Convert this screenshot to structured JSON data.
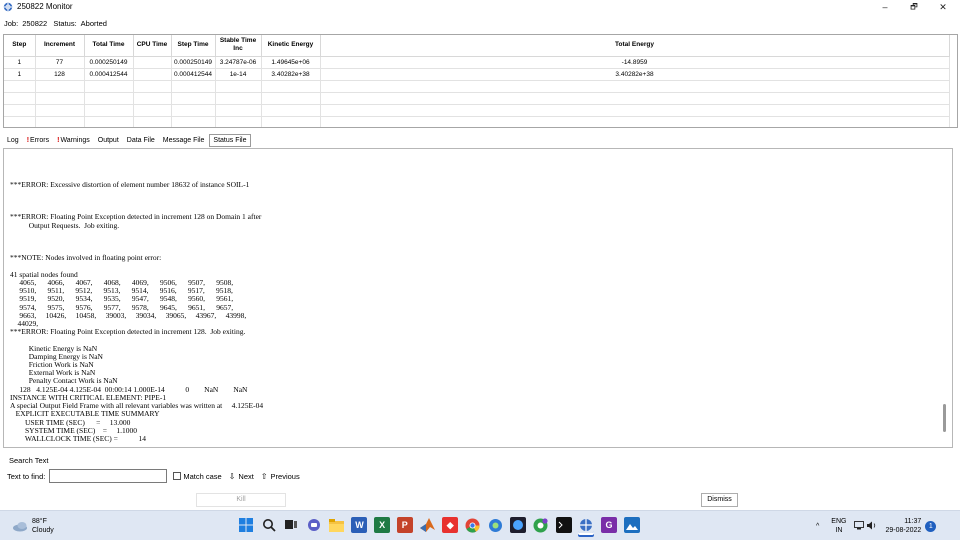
{
  "window": {
    "title": "250822 Monitor",
    "minimize": "–",
    "restore": "🗗",
    "close": "✕"
  },
  "job": {
    "label": "Job:",
    "name": "250822",
    "status_label": "Status:",
    "status": "Aborted"
  },
  "table": {
    "headers": [
      "Step",
      "Increment",
      "Total Time",
      "CPU Time",
      "Step Time",
      "Stable Time Inc",
      "Kinetic Energy",
      "Total Energy"
    ],
    "rows": [
      [
        "1",
        "77",
        "0.000250149",
        "",
        "0.000250149",
        "3.24787e-06",
        "1.49645e+06",
        "-14.8959"
      ],
      [
        "1",
        "128",
        "0.000412544",
        "",
        "0.000412544",
        "1e-14",
        "3.40282e+38",
        "3.40282e+38"
      ]
    ]
  },
  "tabs": [
    {
      "label": "Log",
      "warn": false,
      "active": false
    },
    {
      "label": "Errors",
      "warn": true,
      "active": false
    },
    {
      "label": "Warnings",
      "warn": true,
      "active": false
    },
    {
      "label": "Output",
      "warn": false,
      "active": false
    },
    {
      "label": "Data File",
      "warn": false,
      "active": false
    },
    {
      "label": "Message File",
      "warn": false,
      "active": false
    },
    {
      "label": "Status File",
      "warn": false,
      "active": true
    }
  ],
  "log": {
    "text": "\n\n\n***ERROR: Excessive distortion of element number 18632 of instance SOIL-1\n\n\n\n***ERROR: Floating Point Exception detected in increment 128 on Domain 1 after\n          Output Requests.  Job exiting.\n\n\n\n***NOTE: Nodes involved in floating point error:\n\n41 spatial nodes found\n     4065,      4066,      4067,      4068,      4069,      9506,      9507,      9508,\n     9510,      9511,      9512,      9513,      9514,      9516,      9517,      9518,\n     9519,      9520,      9534,      9535,      9547,      9548,      9560,      9561,\n     9574,      9575,      9576,      9577,      9578,      9645,      9651,      9657,\n     9663,     10426,     10458,     39003,     39034,     39065,     43967,     43998,\n    44029,\n***ERROR: Floating Point Exception detected in increment 128.  Job exiting.\n\n          Kinetic Energy is NaN\n          Damping Energy is NaN\n          Friction Work is NaN\n          External Work is NaN\n          Penalty Contact Work is NaN\n     128   4.125E-04 4.125E-04  00:00:14 1.000E-14           0        NaN        NaN\nINSTANCE WITH CRITICAL ELEMENT: PIPE-1\nA special Output Field Frame with all relevant variables was written at     4.125E-04\n   EXPLICIT EXECUTABLE TIME SUMMARY\n        USER TIME (SEC)      =     13.000\n        SYSTEM TIME (SEC)    =     1.1000\n        WALLCLOCK TIME (SEC) =           14"
  },
  "search": {
    "title": "Search Text",
    "find_label": "Text to find:",
    "find_value": "",
    "match_case": "Match case",
    "next": "Next",
    "previous": "Previous"
  },
  "buttons": {
    "kill": "Kill",
    "dismiss": "Dismiss"
  },
  "taskbar": {
    "weather_temp": "88°F",
    "weather_desc": "Cloudy",
    "lang_top": "ENG",
    "lang_bottom": "IN",
    "time": "11:37",
    "date": "29-08-2022",
    "notifications": "1",
    "chevron": "^"
  },
  "taskbar_apps": [
    "start-icon",
    "search-icon",
    "task-view-icon",
    "chat-icon",
    "file-explorer-icon",
    "word-icon",
    "excel-icon",
    "powerpoint-icon",
    "matlab-icon",
    "anydesk-icon",
    "chrome-icon",
    "app-icon",
    "teams-icon",
    "chrome-profile-icon",
    "terminal-icon",
    "abaqus-monitor-icon",
    "onenote-icon",
    "photos-icon"
  ]
}
